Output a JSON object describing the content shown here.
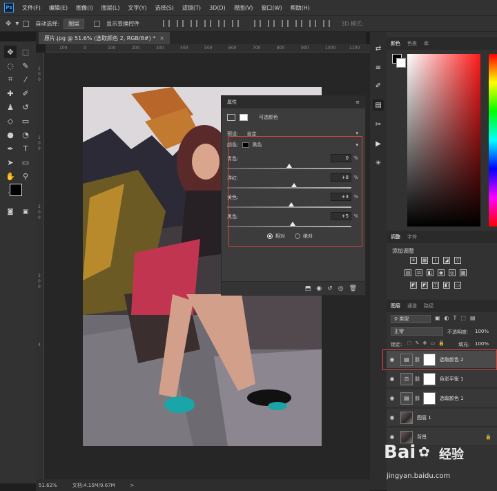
{
  "app": {
    "logo": "Ps"
  },
  "menu": [
    "文件(F)",
    "编辑(E)",
    "图像(I)",
    "图层(L)",
    "文字(Y)",
    "选择(S)",
    "滤镜(T)",
    "3D(D)",
    "视图(V)",
    "窗口(W)",
    "帮助(H)"
  ],
  "options": {
    "auto_select_label": "自动选择:",
    "auto_select_value": "图层",
    "show_transform_label": "显示变换控件",
    "mode_3d_label": "3D 模式:"
  },
  "document": {
    "tab_title": "原片.jpg @ 51.6% (选取颜色 2, RGB/8#) *",
    "tab_close": "×"
  },
  "rulers": {
    "h_ticks": [
      "100",
      "0",
      "100",
      "200",
      "300",
      "400",
      "500",
      "600",
      "700",
      "800",
      "900",
      "1000",
      "1100"
    ],
    "v_ticks": [
      "1",
      "0",
      "0",
      "1",
      "0",
      "0",
      "2",
      "0",
      "0",
      "3",
      "0",
      "0",
      "4"
    ]
  },
  "status": {
    "zoom": "51.62%",
    "doc_info": "文档:4.15M/9.67M",
    "arrow": ">"
  },
  "properties": {
    "panel_title": "属性",
    "panel_type": "可选颜色",
    "preset_label": "预设:",
    "preset_value": "自定",
    "colors_label": "颜色:",
    "colors_value": "黑色",
    "sliders": [
      {
        "label": "青色:",
        "value": "0",
        "unit": "%",
        "level": 50
      },
      {
        "label": "洋红:",
        "value": "+8",
        "unit": "%",
        "level": 54
      },
      {
        "label": "黄色:",
        "value": "+3",
        "unit": "%",
        "level": 51.5
      },
      {
        "label": "黑色:",
        "value": "+5",
        "unit": "%",
        "level": 52.5
      }
    ],
    "method_relative": "相对",
    "method_absolute": "绝对"
  },
  "color_panel": {
    "tabs": [
      "颜色",
      "色板",
      "库"
    ]
  },
  "adjust_panel": {
    "tabs": [
      "调整",
      "字符"
    ],
    "add_label": "添加调整"
  },
  "layers_panel": {
    "tabs": [
      "图层",
      "通道",
      "路径"
    ],
    "filter_kind": "类型",
    "blend_mode": "正常",
    "opacity_label": "不透明度:",
    "opacity_value": "100%",
    "lock_label": "锁定:",
    "fill_label": "填充:",
    "fill_value": "100%",
    "layers": [
      {
        "name": "选取颜色 2",
        "type": "adj",
        "selected": true
      },
      {
        "name": "色彩平衡 1",
        "type": "adj",
        "selected": false
      },
      {
        "name": "选取颜色 1",
        "type": "adj",
        "selected": false
      },
      {
        "name": "图层 1",
        "type": "img",
        "selected": false
      },
      {
        "name": "背景",
        "type": "img",
        "selected": false
      }
    ]
  },
  "watermark": {
    "brand": "Bai",
    "brand2": "经验",
    "url": "jingyan.baidu.com"
  },
  "colors": {
    "accent_red": "#d8473b",
    "ui_dark": "#323232",
    "foreground": "#000000",
    "background": "#ffffff"
  }
}
